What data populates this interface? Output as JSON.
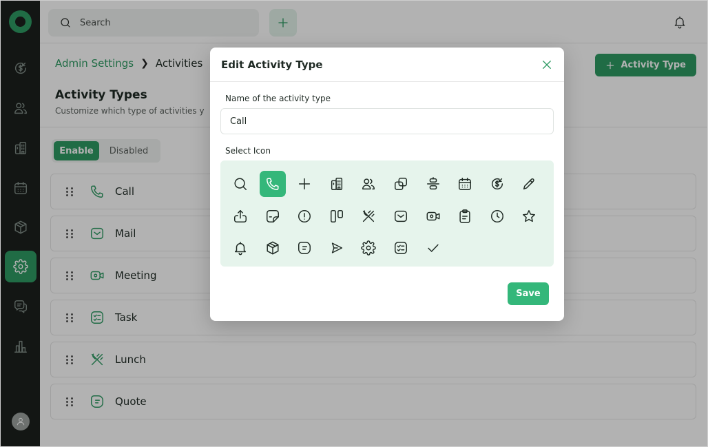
{
  "colors": {
    "accent": "#2f9b64",
    "accent_light": "#34b77a",
    "sidebar": "#1c201e",
    "icon_panel": "#e6f4ec"
  },
  "sidebar": {
    "items": [
      {
        "icon": "dollar-refresh-icon",
        "active": false
      },
      {
        "icon": "users-icon",
        "active": false
      },
      {
        "icon": "building-icon",
        "active": false
      },
      {
        "icon": "calendar-icon",
        "active": false
      },
      {
        "icon": "box-icon",
        "active": false
      },
      {
        "icon": "gear-icon",
        "active": true
      },
      {
        "icon": "chat-icon",
        "active": false
      },
      {
        "icon": "bar-chart-icon",
        "active": false
      }
    ],
    "avatar_icon": "user-icon"
  },
  "topbar": {
    "search_placeholder": "Search",
    "add_icon": "plus-icon",
    "bell_icon": "bell-icon"
  },
  "breadcrumb": {
    "parent": "Admin Settings",
    "current": "Activities"
  },
  "page": {
    "title": "Activity Types",
    "subtitle": "Customize which type of activities y",
    "new_button": "Activity Type"
  },
  "filter": {
    "enable": "Enable",
    "disabled": "Disabled",
    "selected": "Enable"
  },
  "activities": [
    {
      "label": "Call",
      "icon": "phone-icon"
    },
    {
      "label": "Mail",
      "icon": "mail-icon"
    },
    {
      "label": "Meeting",
      "icon": "video-icon"
    },
    {
      "label": "Task",
      "icon": "task-list-icon"
    },
    {
      "label": "Lunch",
      "icon": "cutlery-icon"
    },
    {
      "label": "Quote",
      "icon": "quote-icon"
    }
  ],
  "modal": {
    "title": "Edit Activity Type",
    "name_label": "Name of the activity type",
    "name_value": "Call",
    "icon_label": "Select Icon",
    "selected_icon": "phone-icon",
    "save": "Save",
    "icons": [
      "search-icon",
      "phone-icon",
      "plus-icon",
      "building-icon",
      "users-icon",
      "copy-icon",
      "align-icon",
      "calendar-icon",
      "dollar-refresh-icon",
      "pencil-icon",
      "upload-icon",
      "sticky-note-icon",
      "alert-circle-icon",
      "columns-icon",
      "cutlery-icon",
      "mail-icon",
      "video-icon",
      "clipboard-icon",
      "clock-icon",
      "star-icon",
      "bell-icon",
      "box-icon",
      "quote-icon",
      "send-icon",
      "gear-icon",
      "task-list-icon",
      "check-icon"
    ]
  }
}
